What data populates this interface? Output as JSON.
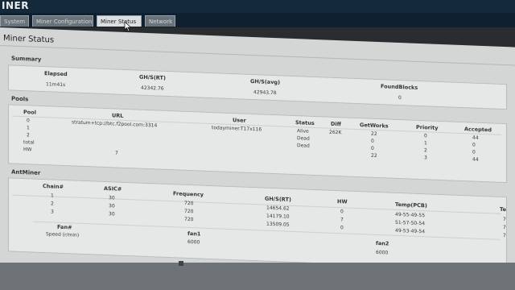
{
  "app": {
    "brand": "INER"
  },
  "tabs": [
    "System",
    "Miner Configuration",
    "Miner Status",
    "Network"
  ],
  "page": {
    "title": "Miner Status"
  },
  "summary": {
    "label": "Summary",
    "headers": [
      "Elapsed",
      "GH/S(RT)",
      "GH/S(avg)",
      "FoundBlocks"
    ],
    "values": [
      "11m41s",
      "42342.76",
      "42943.78",
      "0"
    ]
  },
  "pools": {
    "label": "Pools",
    "headers": [
      "Pool",
      "URL",
      "User",
      "Status",
      "Diff",
      "GetWorks",
      "Priority",
      "Accepted"
    ],
    "rows": [
      [
        "0",
        "stratum+tcp://btc.f2pool.com:3314",
        "todayminer.T17x116",
        "Alive",
        "262K",
        "22",
        "0",
        "44"
      ],
      [
        "1",
        "",
        "",
        "Dead",
        "",
        "0",
        "1",
        "0"
      ],
      [
        "2",
        "",
        "",
        "Dead",
        "",
        "0",
        "2",
        "0"
      ],
      [
        "total",
        "",
        "",
        "",
        "",
        "22",
        "3",
        "44"
      ]
    ],
    "hw_label": "HW",
    "hw_value": "7"
  },
  "antminer": {
    "label": "AntMiner",
    "headers": [
      "Chain#",
      "ASIC#",
      "Frequency",
      "GH/S(RT)",
      "HW",
      "Temp(PCB)",
      "Te"
    ],
    "rows": [
      [
        "1",
        "30",
        "720",
        "14654.62",
        "0",
        "49-55-49-55",
        "7"
      ],
      [
        "2",
        "30",
        "720",
        "14179.10",
        "7",
        "51-57-50-54",
        "7"
      ],
      [
        "3",
        "30",
        "720",
        "13509.05",
        "0",
        "49-53-49-54",
        "7"
      ]
    ],
    "fan_header": "Fan#",
    "fan_row_label": "Speed (r/min)",
    "fans": [
      {
        "name": "fan1",
        "speed": "6000"
      },
      {
        "name": "fan2",
        "speed": "6000"
      }
    ]
  },
  "colors": {
    "header_bg": "#14293a",
    "tab_active": "#dcdfe0",
    "panel_bg": "#e6e8e8"
  }
}
